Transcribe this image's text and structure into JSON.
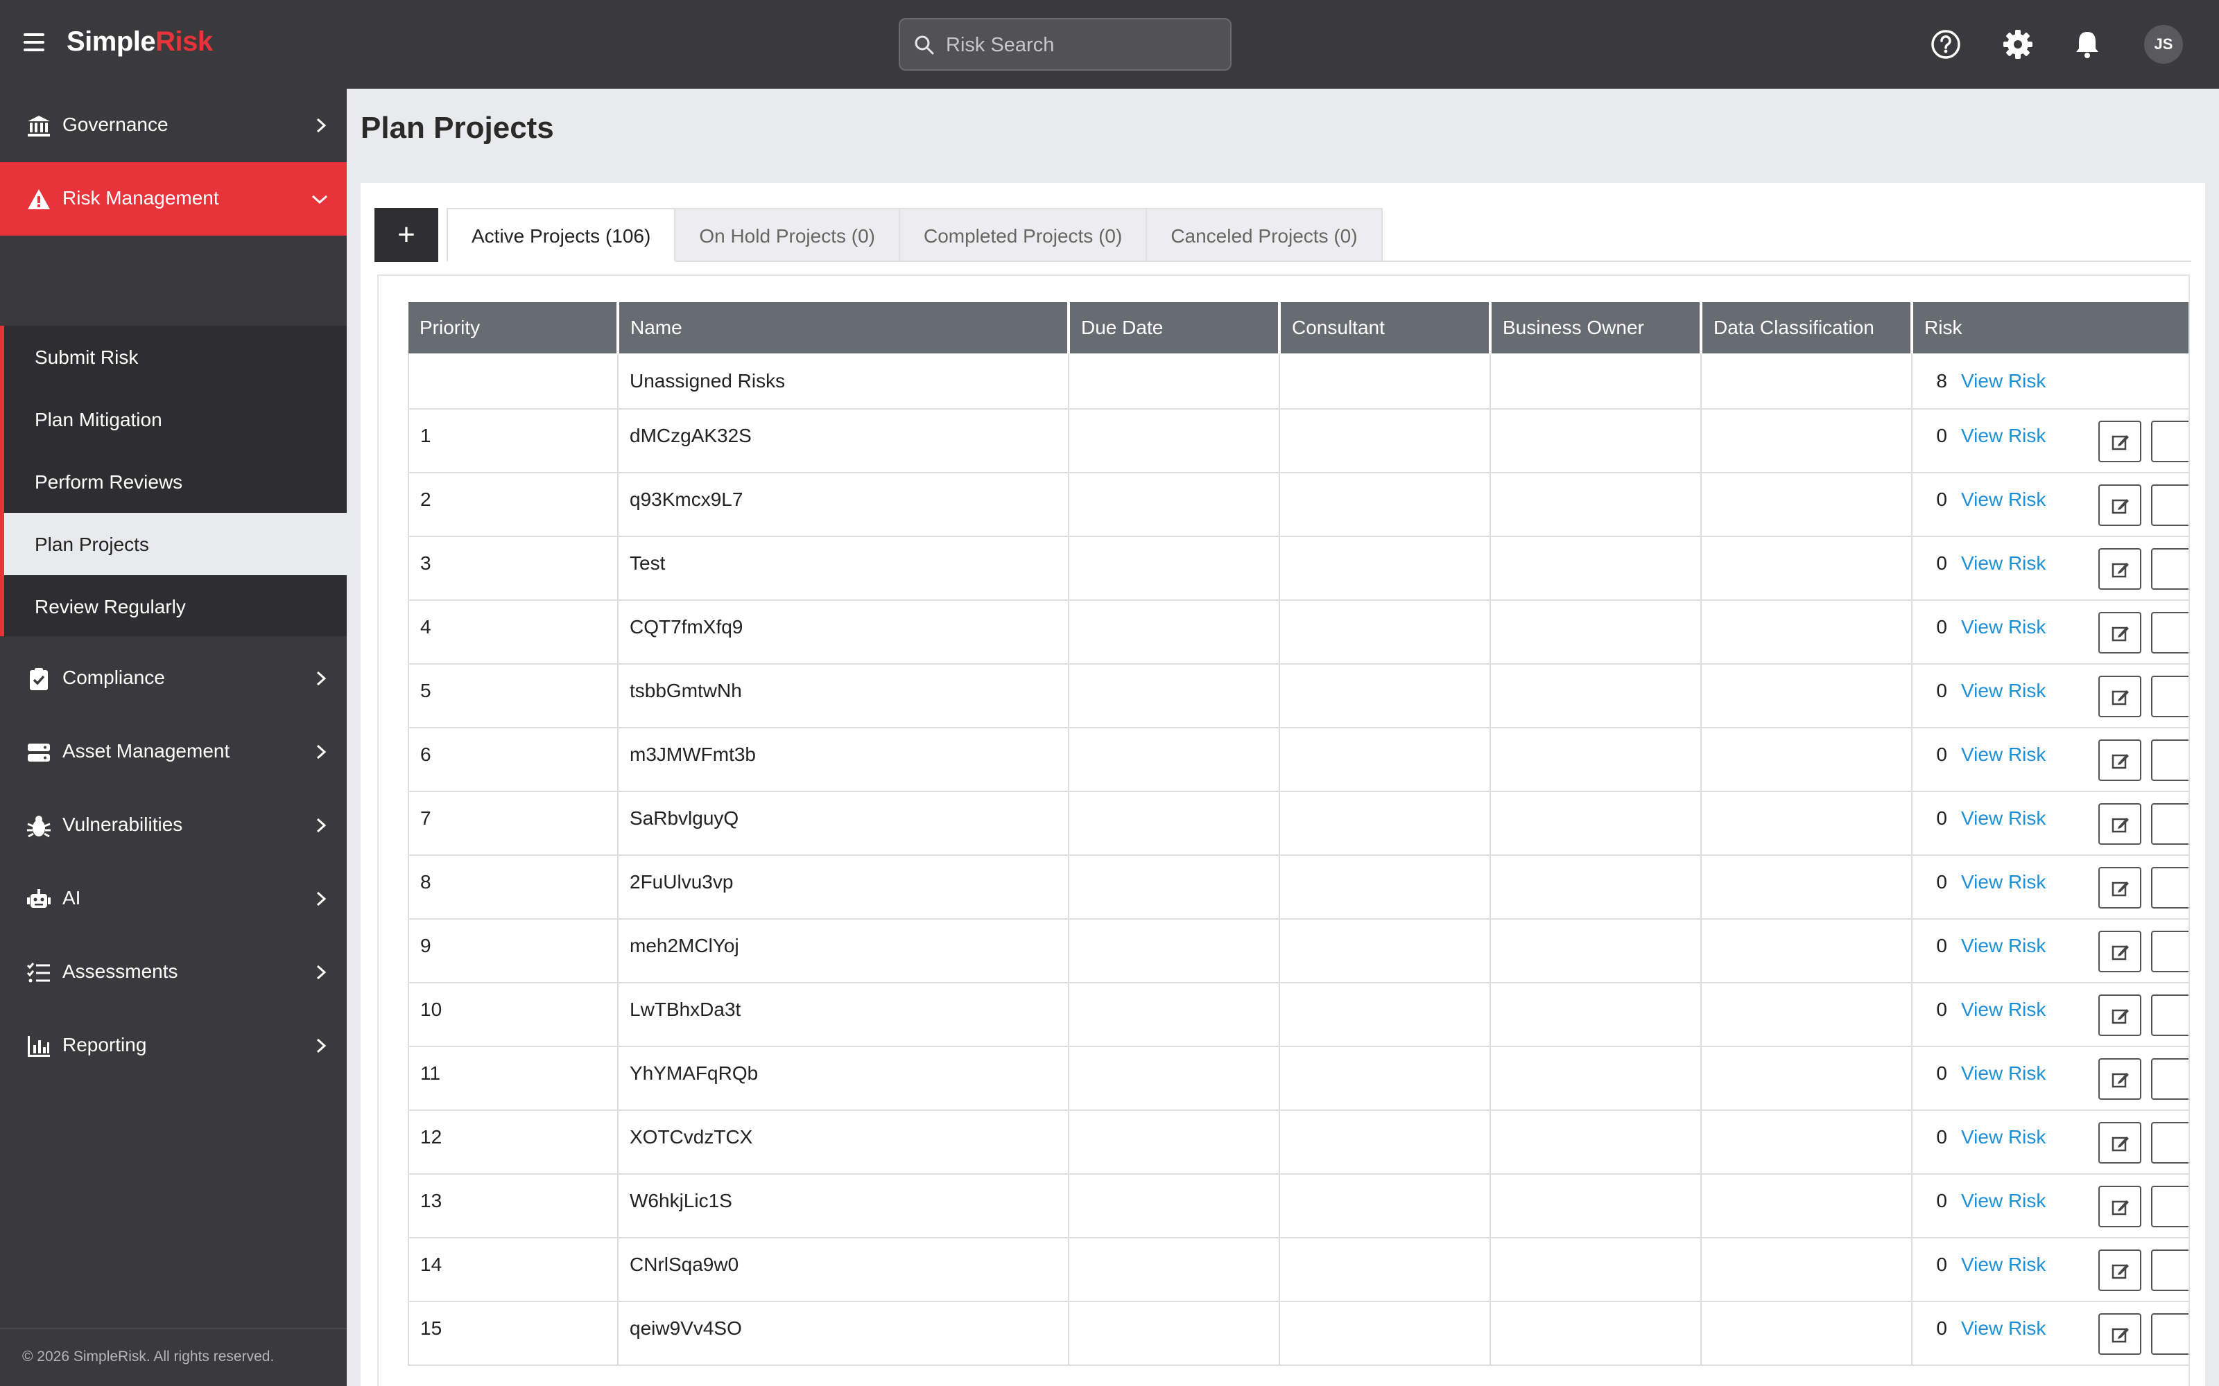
{
  "header": {
    "logo_main": "Simple",
    "logo_accent": "Risk",
    "search_placeholder": "Risk Search",
    "avatar_initials": "JS"
  },
  "sidebar": {
    "items": [
      {
        "label": "Governance",
        "icon": "bank-icon"
      },
      {
        "label": "Risk Management",
        "icon": "warning-icon",
        "active": true
      },
      {
        "label": "Compliance",
        "icon": "clipboard-check-icon"
      },
      {
        "label": "Asset Management",
        "icon": "server-icon"
      },
      {
        "label": "Vulnerabilities",
        "icon": "bug-icon"
      },
      {
        "label": "AI",
        "icon": "robot-icon"
      },
      {
        "label": "Assessments",
        "icon": "list-check-icon"
      },
      {
        "label": "Reporting",
        "icon": "bar-chart-icon"
      }
    ],
    "submenu": [
      {
        "label": "Submit Risk"
      },
      {
        "label": "Plan Mitigation"
      },
      {
        "label": "Perform Reviews"
      },
      {
        "label": "Plan Projects",
        "selected": true
      },
      {
        "label": "Review Regularly"
      }
    ],
    "footer": "© 2026 SimpleRisk. All rights reserved."
  },
  "main": {
    "title": "Plan Projects",
    "add_label": "+",
    "tabs": [
      {
        "label": "Active Projects (106)",
        "active": true
      },
      {
        "label": "On Hold Projects (0)"
      },
      {
        "label": "Completed Projects (0)"
      },
      {
        "label": "Canceled Projects (0)"
      }
    ],
    "table": {
      "columns": [
        "Priority",
        "Name",
        "Due Date",
        "Consultant",
        "Business Owner",
        "Data Classification",
        "Risk"
      ],
      "view_label": "View Risk",
      "unassigned": {
        "name": "Unassigned Risks",
        "risk_count": "8"
      },
      "rows": [
        {
          "priority": "1",
          "name": "dMCzgAK32S",
          "risk_count": "0"
        },
        {
          "priority": "2",
          "name": "q93Kmcx9L7",
          "risk_count": "0"
        },
        {
          "priority": "3",
          "name": "Test",
          "risk_count": "0"
        },
        {
          "priority": "4",
          "name": "CQT7fmXfq9",
          "risk_count": "0"
        },
        {
          "priority": "5",
          "name": "tsbbGmtwNh",
          "risk_count": "0"
        },
        {
          "priority": "6",
          "name": "m3JMWFmt3b",
          "risk_count": "0"
        },
        {
          "priority": "7",
          "name": "SaRbvlguyQ",
          "risk_count": "0"
        },
        {
          "priority": "8",
          "name": "2FuUlvu3vp",
          "risk_count": "0"
        },
        {
          "priority": "9",
          "name": "meh2MClYoj",
          "risk_count": "0"
        },
        {
          "priority": "10",
          "name": "LwTBhxDa3t",
          "risk_count": "0"
        },
        {
          "priority": "11",
          "name": "YhYMAFqRQb",
          "risk_count": "0"
        },
        {
          "priority": "12",
          "name": "XOTCvdzTCX",
          "risk_count": "0"
        },
        {
          "priority": "13",
          "name": "W6hkjLic1S",
          "risk_count": "0"
        },
        {
          "priority": "14",
          "name": "CNrlSqa9w0",
          "risk_count": "0"
        },
        {
          "priority": "15",
          "name": "qeiw9Vv4SO",
          "risk_count": "0"
        }
      ]
    }
  },
  "colors": {
    "brand_red": "#e8333a",
    "dark_bg": "#3a3a3c",
    "link_blue": "#1c8fd6",
    "table_header": "#676b72"
  }
}
